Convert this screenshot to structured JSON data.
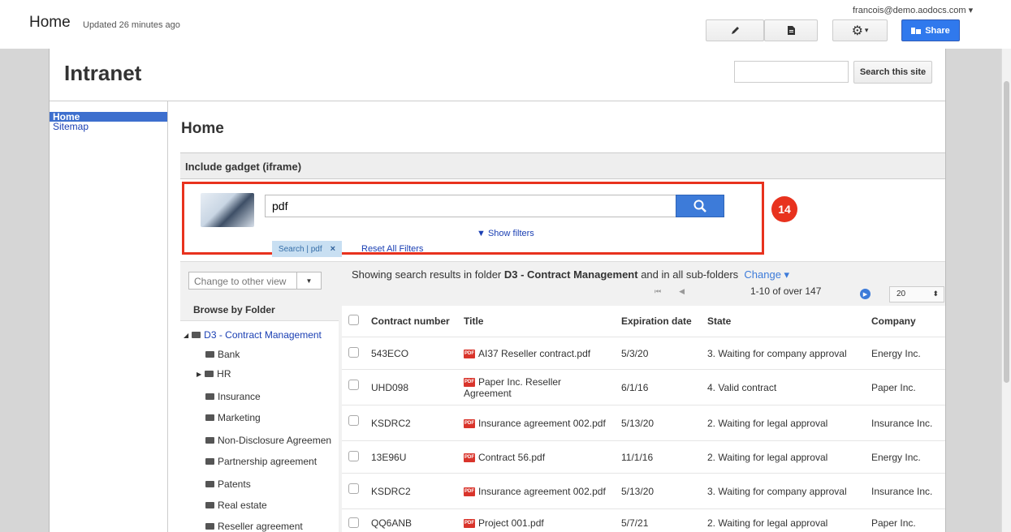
{
  "topbar": {
    "title": "Home",
    "updated": "Updated 26 minutes ago",
    "user": "francois@demo.aodocs.com",
    "share_label": "Share"
  },
  "site": {
    "title": "Intranet",
    "search_button": "Search this site"
  },
  "nav": {
    "items": [
      {
        "label": "Home",
        "active": true
      },
      {
        "label": "Sitemap",
        "active": false
      }
    ]
  },
  "page": {
    "title": "Home",
    "gadget_header": "Include gadget (iframe)"
  },
  "search": {
    "query": "pdf",
    "show_filters": "▼ Show filters",
    "filter_tag": "Search | pdf",
    "filter_tag_close": "×",
    "reset_filters": "Reset All Filters",
    "badge": "14"
  },
  "browser": {
    "view_select": "Change to other view",
    "browse_header": "Browse by Folder",
    "folders": [
      "D3 - Contract Management",
      "Bank",
      "HR",
      "Insurance",
      "Marketing",
      "Non-Disclosure Agreemen",
      "Partnership agreement",
      "Patents",
      "Real estate",
      "Reseller agreement"
    ]
  },
  "results": {
    "info_prefix": "Showing search results in folder ",
    "folder": "D3 - Contract Management",
    "info_suffix": " and in all sub-folders",
    "change_label": "Change ▾",
    "range": "1-10 of over 147",
    "page_size": "20",
    "columns": [
      "Contract number",
      "Title",
      "Expiration date",
      "State",
      "Company"
    ],
    "rows": [
      {
        "number": "543ECO",
        "title": "AI37 Reseller contract.pdf",
        "expiration": "5/3/20",
        "state": "3. Waiting for company approval",
        "company": "Energy Inc."
      },
      {
        "number": "UHD098",
        "title": "Paper Inc. Reseller Agreement",
        "expiration": "6/1/16",
        "state": "4. Valid contract",
        "company": "Paper Inc."
      },
      {
        "number": "KSDRC2",
        "title": "Insurance agreement 002.pdf",
        "expiration": "5/13/20",
        "state": "2. Waiting for legal approval",
        "company": "Insurance Inc."
      },
      {
        "number": "13E96U",
        "title": "Contract 56.pdf",
        "expiration": "11/1/16",
        "state": "2. Waiting for legal approval",
        "company": "Energy Inc."
      },
      {
        "number": "KSDRC2",
        "title": "Insurance agreement 002.pdf",
        "expiration": "5/13/20",
        "state": "3. Waiting for company approval",
        "company": "Insurance Inc."
      },
      {
        "number": "QQ6ANB",
        "title": "Project 001.pdf",
        "expiration": "5/7/21",
        "state": "2. Waiting for legal approval",
        "company": "Paper Inc."
      }
    ]
  }
}
